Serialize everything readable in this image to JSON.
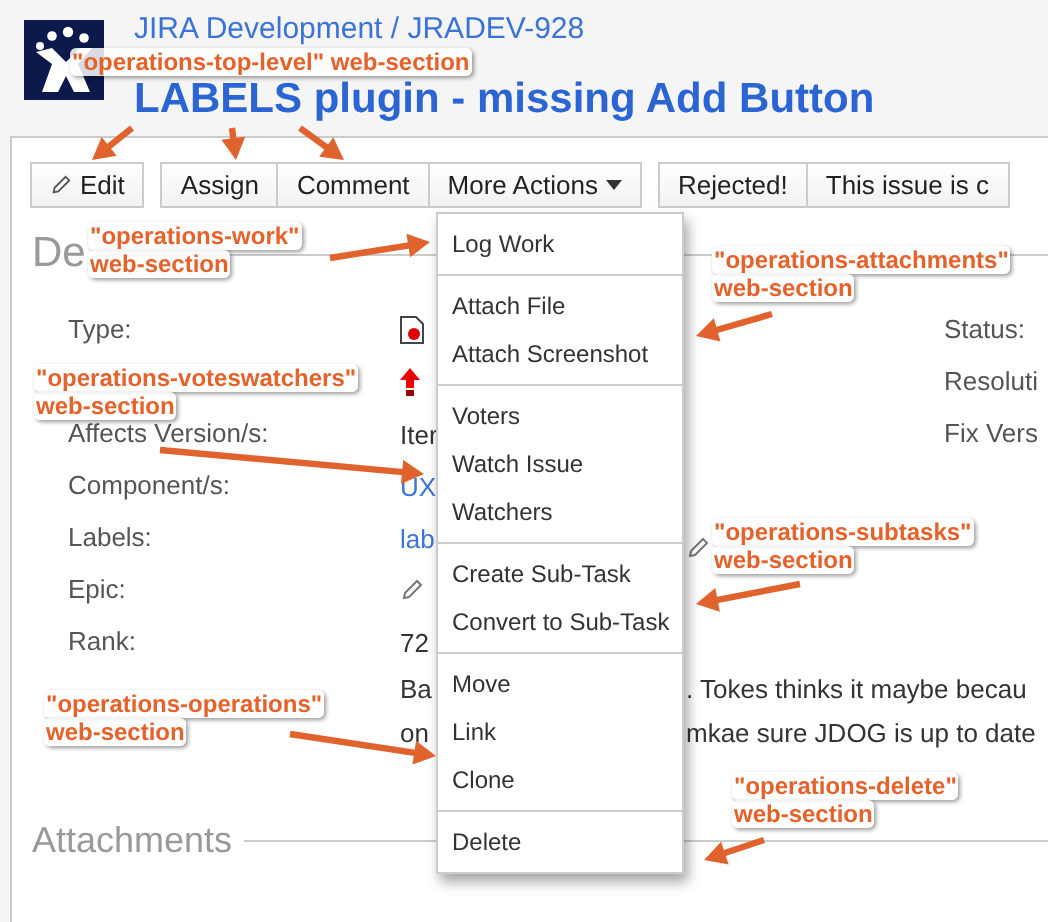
{
  "header": {
    "breadcrumb": "JIRA Development / JRADEV-928",
    "title": "LABELS plugin - missing Add Button"
  },
  "toolbar": [
    {
      "label": "Edit",
      "kind": "edit"
    },
    {
      "label": "Assign",
      "kind": "plain"
    },
    {
      "label": "Comment",
      "kind": "plain"
    },
    {
      "label": "More Actions",
      "kind": "dropdown"
    },
    {
      "label": "Rejected!",
      "kind": "plain"
    },
    {
      "label": "This issue is c",
      "kind": "plain"
    }
  ],
  "details": {
    "heading": "De",
    "fields": [
      {
        "label": "Type:",
        "kind": "bug-icon"
      },
      {
        "kind": "priority-icon"
      },
      {
        "label": "Affects Version/s:",
        "kind": "text",
        "value": "Iter"
      },
      {
        "label": "Component/s:",
        "kind": "link",
        "value": "UX"
      },
      {
        "label": "Labels:",
        "kind": "link",
        "value": "lab"
      },
      {
        "label": "Epic:",
        "kind": "edit-icon"
      },
      {
        "label": "Rank:",
        "kind": "text",
        "value": "72"
      },
      {
        "kind": "split",
        "lines": [
          [
            "Ba",
            ". Tokes thinks it maybe becau"
          ],
          [
            "on",
            "mkae sure JDOG is up to date"
          ]
        ]
      }
    ],
    "side_fields": [
      "Status:",
      "Resoluti",
      "Fix Vers"
    ]
  },
  "attachments_heading": "Attachments",
  "menu": [
    [
      "Log Work"
    ],
    [
      "Attach File",
      "Attach Screenshot"
    ],
    [
      "Voters",
      "Watch Issue",
      "Watchers"
    ],
    [
      "Create Sub-Task",
      "Convert to Sub-Task"
    ],
    [
      "Move",
      "Link",
      "Clone"
    ],
    [
      "Delete"
    ]
  ],
  "annotations": [
    {
      "lines": [
        "\"operations-top-level\" web-section"
      ]
    },
    {
      "lines": [
        "\"operations-work\"",
        "web-section"
      ]
    },
    {
      "lines": [
        "\"operations-attachments\"",
        "web-section"
      ]
    },
    {
      "lines": [
        "\"operations-voteswatchers\"",
        "web-section"
      ]
    },
    {
      "lines": [
        "\"operations-subtasks\"",
        "web-section"
      ]
    },
    {
      "lines": [
        "\"operations-operations\"",
        "web-section"
      ]
    },
    {
      "lines": [
        "\"operations-delete\"",
        "web-section"
      ]
    }
  ]
}
